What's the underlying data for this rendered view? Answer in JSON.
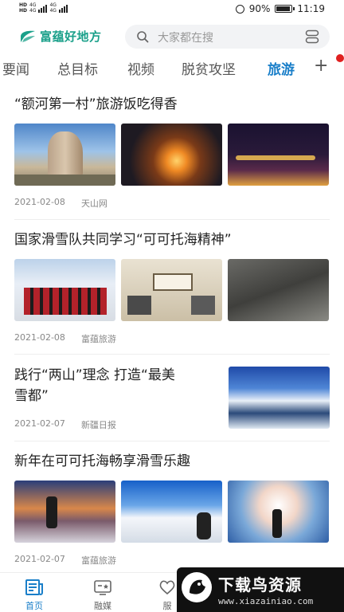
{
  "status_bar": {
    "network_top": "4G",
    "network_bottom": "4G",
    "battery_percent": "90%",
    "battery_level": 0.9,
    "time": "11:19"
  },
  "header": {
    "logo_text": "富蕴好地方",
    "search_placeholder": "大家都在搜",
    "brand_color": "#1aa08a"
  },
  "tabs": {
    "items": [
      {
        "label": "要闻",
        "active": false
      },
      {
        "label": "总目标",
        "active": false
      },
      {
        "label": "视频",
        "active": false
      },
      {
        "label": "脱贫攻坚",
        "active": false
      },
      {
        "label": "旅游",
        "active": true
      }
    ],
    "add_label": "+",
    "accent_color": "#1a7fc9"
  },
  "articles": [
    {
      "title": "“额河第一村”旅游饭吃得香",
      "date": "2021-02-08",
      "source": "天山网",
      "images": [
        "stone-monument-photo",
        "bonfire-night-photo",
        "night-lights-village-photo"
      ]
    },
    {
      "title": "国家滑雪队共同学习“可可托海精神”",
      "date": "2021-02-08",
      "source": "富蕴旅游",
      "images": [
        "team-group-photo",
        "exhibition-photo",
        "mining-history-photo"
      ]
    },
    {
      "title_line1": "践行“两山”理念 打造“最美",
      "title_line2": "雪都”",
      "date": "2021-02-07",
      "source": "新疆日报",
      "images": [
        "snow-river-photo"
      ]
    },
    {
      "title": "新年在可可托海畅享滑雪乐趣",
      "date": "2021-02-07",
      "source": "富蕴旅游",
      "images": [
        "sunset-skier-photo",
        "snow-slope-photo",
        "snow-splash-photo"
      ]
    }
  ],
  "bottom_nav": {
    "items": [
      {
        "label": "首页",
        "icon": "newspaper-icon",
        "active": true
      },
      {
        "label": "融媒",
        "icon": "tv-icon",
        "active": false
      },
      {
        "label": "服",
        "icon": "heart-icon",
        "active": false
      }
    ]
  },
  "watermark": {
    "title": "下载鸟资源",
    "url": "www.xiazainiao.com"
  }
}
